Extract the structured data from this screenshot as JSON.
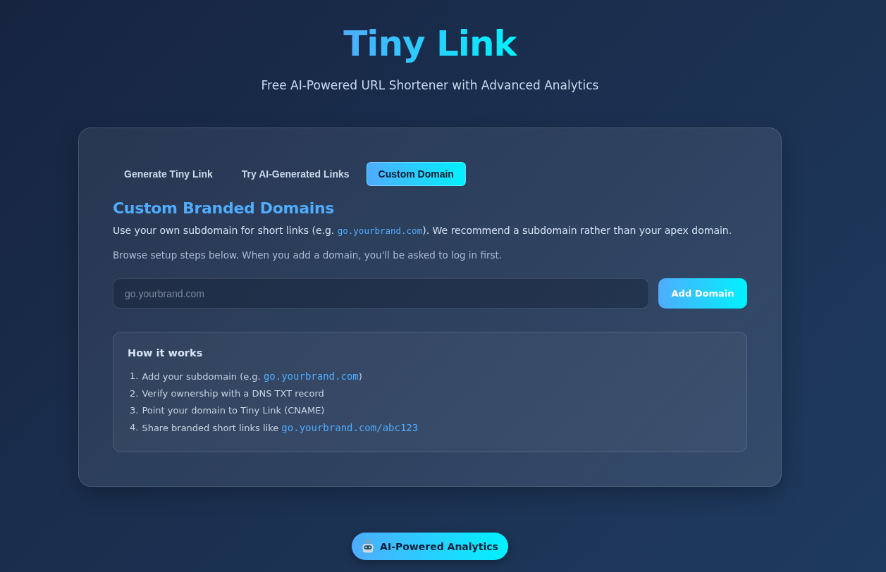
{
  "header": {
    "title": "Tiny Link",
    "subtitle": "Free AI-Powered URL Shortener with Advanced Analytics"
  },
  "tabs": [
    {
      "label": "Generate Tiny Link",
      "selected": false
    },
    {
      "label": "Try AI-Generated Links",
      "selected": false
    },
    {
      "label": "Custom Domain",
      "selected": true
    }
  ],
  "panel": {
    "heading": "Custom Branded Domains",
    "intro": [
      {
        "kind": "text",
        "text": "Use your own subdomain for short links (e.g. "
      },
      {
        "kind": "code",
        "text": "go.yourbrand.com"
      },
      {
        "kind": "text",
        "text": "). We recommend a subdomain rather than your apex domain."
      }
    ],
    "note": "Browse setup steps below. When you add a domain, you'll be asked to log in first.",
    "domain_field": {
      "placeholder": "go.yourbrand.com"
    },
    "add_button": "Add Domain",
    "how_it_works": {
      "title": "How it works",
      "steps": [
        {
          "number": "1.",
          "parts": [
            {
              "kind": "text",
              "text": "Add your subdomain (e.g. "
            },
            {
              "kind": "code",
              "text": "go.yourbrand.com"
            },
            {
              "kind": "text",
              "text": ")"
            }
          ]
        },
        {
          "number": "2.",
          "parts": [
            {
              "kind": "text",
              "text": "Verify ownership with a DNS TXT record"
            }
          ]
        },
        {
          "number": "3.",
          "parts": [
            {
              "kind": "text",
              "text": "Point your domain to Tiny Link (CNAME)"
            }
          ]
        },
        {
          "number": "4.",
          "parts": [
            {
              "kind": "text",
              "text": "Share branded short links like "
            },
            {
              "kind": "code",
              "text": "go.yourbrand.com/abc123"
            }
          ]
        }
      ]
    }
  },
  "badge": {
    "label": "AI-Powered Analytics"
  }
}
